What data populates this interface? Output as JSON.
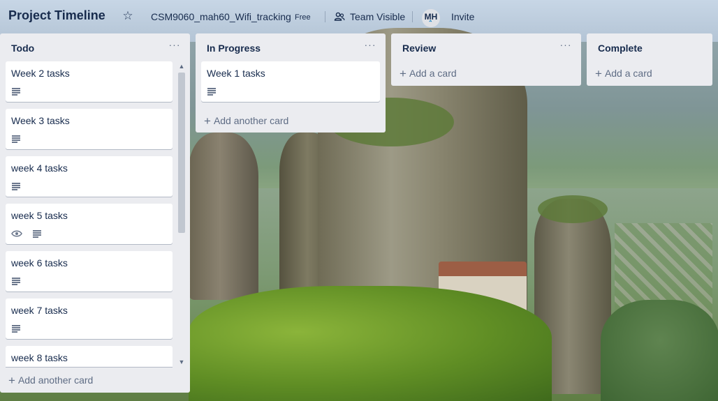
{
  "board": {
    "title": "Project Timeline",
    "team_name": "CSM9060_mah60_Wifi_tracking",
    "team_plan": "Free",
    "visibility": "Team Visible",
    "member_initials": "MH",
    "invite_label": "Invite"
  },
  "icons": {
    "star": "star-icon",
    "visibility": "team-visibility-icon",
    "list_menu": "more-dots-icon",
    "description": "description-icon",
    "watch": "eye-icon",
    "add": "plus-icon"
  },
  "lists": [
    {
      "title": "Todo",
      "cards": [
        {
          "title": "Week 2 tasks",
          "badges": [
            "description"
          ]
        },
        {
          "title": "Week 3 tasks",
          "badges": [
            "description"
          ]
        },
        {
          "title": "week 4 tasks",
          "badges": [
            "description"
          ]
        },
        {
          "title": "week 5 tasks",
          "badges": [
            "watch",
            "description"
          ]
        },
        {
          "title": "week 6 tasks",
          "badges": [
            "description"
          ]
        },
        {
          "title": "week 7 tasks",
          "badges": [
            "description"
          ]
        },
        {
          "title": "week 8 tasks",
          "badges": []
        }
      ],
      "add_label": "Add another card"
    },
    {
      "title": "In Progress",
      "cards": [
        {
          "title": "Week 1 tasks",
          "badges": [
            "description"
          ]
        }
      ],
      "add_label": "Add another card"
    },
    {
      "title": "Review",
      "cards": [],
      "add_label": "Add a card"
    },
    {
      "title": "Complete",
      "cards": [],
      "add_label": "Add a card"
    }
  ],
  "colors": {
    "list_bg": "#ebecf0",
    "text_primary": "#172b4d",
    "text_secondary": "#5e6c84",
    "accent": "#0079bf"
  }
}
